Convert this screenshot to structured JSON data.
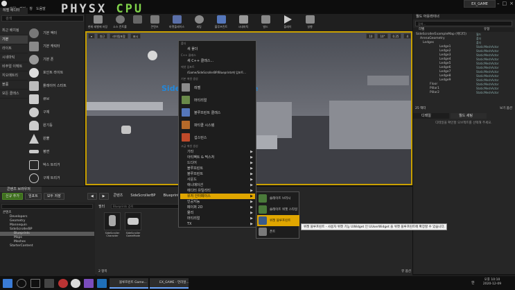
{
  "menubar": {
    "items": [
      "파일",
      "편집",
      "창",
      "도움말"
    ]
  },
  "physx": {
    "a": "PHYSX",
    "b": "CPU"
  },
  "project": {
    "name": "EX_GAME"
  },
  "window_tab": {
    "label": "레벨 에디터"
  },
  "place": {
    "search": "검색",
    "categories": [
      "최근 배치됨",
      "기본",
      "라이트",
      "시네마틱",
      "비주얼 이펙트",
      "지오메트리",
      "볼륨",
      "모든 클래스"
    ],
    "items": [
      "기본 액터",
      "기본 캐릭터",
      "기본 폰",
      "포인트 라이트",
      "플레이어 스타트",
      "큐브",
      "구체",
      "원기둥",
      "원뿔",
      "평면",
      "박스 트리거",
      "구체 트리거"
    ]
  },
  "toolbar": {
    "buttons": [
      "현재 레벨에 저장",
      "소스 컨트롤",
      "콘텐츠",
      "마켓플레이스",
      "세팅",
      "블루프린트",
      "시네마틱",
      "빌드",
      "플레이",
      "실행"
    ]
  },
  "viewport": {
    "persp": "원근",
    "lit": "라이팅포함",
    "show": "표시",
    "title_text": "Side Scroller Template",
    "snap": "10",
    "angle": "10°",
    "scale": "0.25",
    "speed": "4"
  },
  "ctx": {
    "h_folder": "폴더",
    "new_folder": "새 폴더",
    "h_cpp": "C++ 클래스",
    "new_cpp": "새 C++ 클래스...",
    "h_import": "에셋 임포트",
    "import_to": "/Game/SideScrollerBP/Blueprints에 임포트...",
    "h_basic": "기본 에셋 생성",
    "basic": [
      "레벨",
      "머티리얼",
      "블루프린트 클래스",
      "파티클 시스템",
      "섭스턴스"
    ],
    "h_adv": "고급 에셋 생성",
    "adv": [
      "기타",
      "아티팩트 & 찍스처",
      "드디어",
      "블루프린트",
      "블루프린트",
      "사운드",
      "애니메이션",
      "페이퍼 2D",
      "에디터 유틸리티",
      "유저 인터페이스",
      "인공지능",
      "페이퍼 2D",
      "물리",
      "머티리얼",
      "TX"
    ]
  },
  "sub": {
    "items": [
      "슬레이트 브러시",
      "슬레이트 위젯 스타일",
      "위젯 블루프린트",
      "폰트"
    ]
  },
  "tooltip": {
    "text": "위젯 블루프린트 - 사용자 위젯 기능 UWidget 인 UUserWidget 을 위젯 블루프린트에 확장할 수 있습니다."
  },
  "outliner": {
    "tab": "월드 아웃라이너",
    "search": "검색...",
    "col_label": "라벨",
    "col_type": "유형",
    "rows": [
      {
        "label": "SideScrollerExampleMap (에디터)",
        "type": "월드"
      },
      {
        "label": "ArenaGeometry",
        "type": "폴더"
      },
      {
        "label": "Ledges",
        "type": "폴더"
      },
      {
        "label": "Ledge1",
        "type": "StaticMeshActor"
      },
      {
        "label": "Ledge2",
        "type": "StaticMeshActor"
      },
      {
        "label": "Ledge3",
        "type": "StaticMeshActor"
      },
      {
        "label": "Ledge4",
        "type": "StaticMeshActor"
      },
      {
        "label": "Ledge5",
        "type": "StaticMeshActor"
      },
      {
        "label": "Ledge6",
        "type": "StaticMeshActor"
      },
      {
        "label": "Ledge7",
        "type": "StaticMeshActor"
      },
      {
        "label": "Ledge8",
        "type": "StaticMeshActor"
      },
      {
        "label": "Ledge9",
        "type": "StaticMeshActor"
      },
      {
        "label": "Floor",
        "type": "StaticMeshActor"
      },
      {
        "label": "Pillar1",
        "type": "StaticMeshActor"
      },
      {
        "label": "Pillar2",
        "type": "StaticMeshActor"
      }
    ],
    "count": "25 액터",
    "view": "보기 옵션"
  },
  "details": {
    "tab1": "디테일",
    "tab2": "월드 세팅",
    "empty": "디테일을 확인할 오브젝트를 선택해 주세요."
  },
  "cb": {
    "tab": "콘텐츠 브라우저",
    "add": "신규 추가",
    "import": "임포트",
    "saveall": "모두 저장",
    "path": [
      "콘텐츠",
      "SideScrollerBP",
      "Blueprints"
    ],
    "filter": "필터",
    "search": "Blueprints 검색",
    "tree": [
      "콘텐츠",
      "Developers",
      "Geometry",
      "Mannequin",
      "SideScrollerBP",
      "Blueprints",
      "Maps",
      "Meshes",
      "StarterContent"
    ],
    "assets": [
      "SideScroller Character",
      "SideScroller GameMode"
    ],
    "count": "2 항목",
    "view": "뷰 옵션"
  },
  "taskbar": {
    "search": "검색",
    "app1": "블루프린트 Game...",
    "app2": "EX_GAME - 언리얼...",
    "time": "오후 10:10",
    "date": "2020-12-09",
    "lang": "한"
  }
}
